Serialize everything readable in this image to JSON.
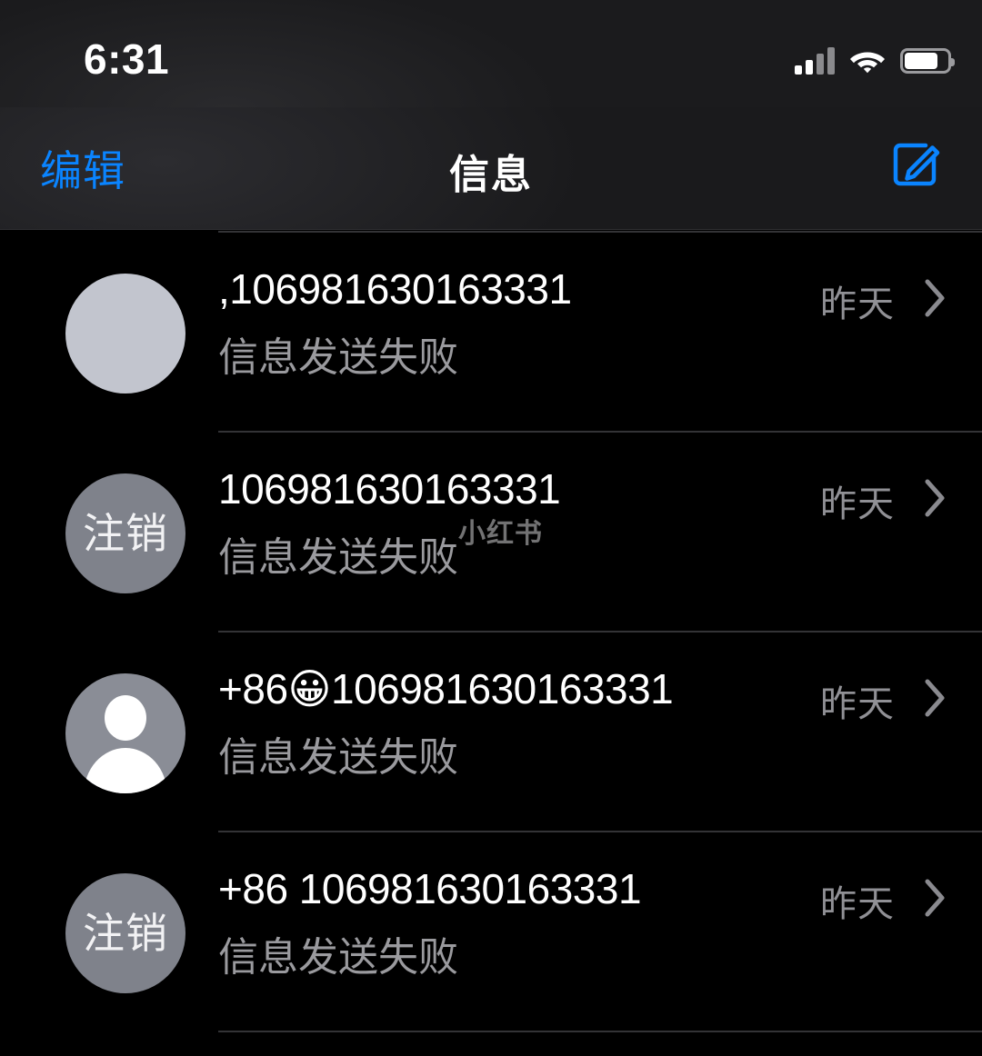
{
  "status_bar": {
    "time": "6:31",
    "signal_icon": "cellular-signal-icon",
    "wifi_icon": "wifi-icon",
    "battery_icon": "battery-icon",
    "signal_bars_filled": 2,
    "signal_bars_total": 4,
    "battery_level_percent": 72
  },
  "nav": {
    "edit_label": "编辑",
    "title": "信息",
    "compose_icon": "compose-message-icon",
    "accent_color": "#0a84ff"
  },
  "colors": {
    "background": "#000000",
    "nav_background": "#1b1b1d",
    "title_text": "#ffffff",
    "subtitle_text": "#9a9a9e",
    "timestamp_text": "#909095",
    "separator": "#333336",
    "avatar_blank": "#c2c5ce",
    "avatar_initials_bg": "#7f828b",
    "avatar_person_bg": "#8a8d96"
  },
  "watermark": {
    "text": "小红书"
  },
  "conversations": [
    {
      "title": ",106981630163331",
      "subtitle": "信息发送失败",
      "timestamp": "昨天",
      "avatar_type": "blank",
      "avatar_label": ""
    },
    {
      "title": "106981630163331",
      "subtitle": "信息发送失败",
      "timestamp": "昨天",
      "avatar_type": "initials",
      "avatar_label": "注销"
    },
    {
      "title": "+86😀106981630163331",
      "subtitle": "信息发送失败",
      "timestamp": "昨天",
      "avatar_type": "person",
      "avatar_label": ""
    },
    {
      "title": "+86 106981630163331",
      "subtitle": "信息发送失败",
      "timestamp": "昨天",
      "avatar_type": "initials",
      "avatar_label": "注销"
    }
  ]
}
